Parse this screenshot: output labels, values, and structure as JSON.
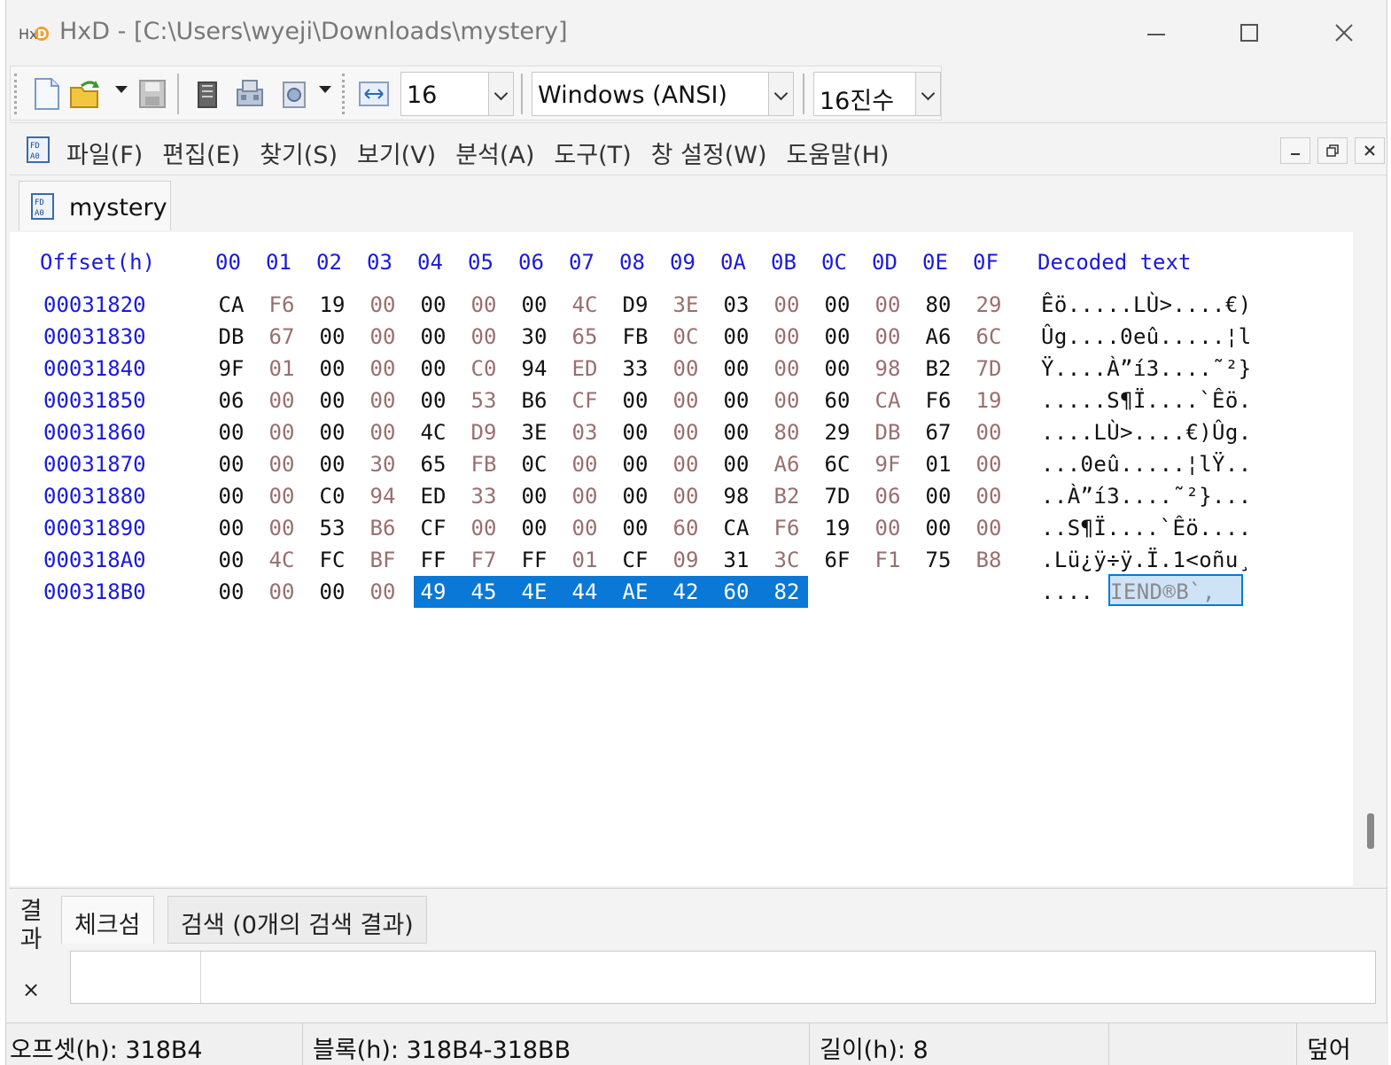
{
  "window": {
    "title": "HxD - [C:\\Users\\wyeji\\Downloads\\mystery]"
  },
  "toolbar": {
    "bytes_per_row": "16",
    "charset": "Windows (ANSI)",
    "number_base": "16진수"
  },
  "menu": {
    "items": [
      "파일(F)",
      "편집(E)",
      "찾기(S)",
      "보기(V)",
      "분석(A)",
      "도구(T)",
      "창 설정(W)",
      "도움말(H)"
    ]
  },
  "document_tab": {
    "label": "mystery"
  },
  "hex_view": {
    "offset_header": "Offset(h)",
    "columns": [
      "00",
      "01",
      "02",
      "03",
      "04",
      "05",
      "06",
      "07",
      "08",
      "09",
      "0A",
      "0B",
      "0C",
      "0D",
      "0E",
      "0F"
    ],
    "decoded_header": "Decoded text",
    "rows": [
      {
        "offset": "00031820",
        "bytes": [
          "CA",
          "F6",
          "19",
          "00",
          "00",
          "00",
          "00",
          "4C",
          "D9",
          "3E",
          "03",
          "00",
          "00",
          "00",
          "80",
          "29"
        ],
        "text": "Êö.....LÙ>....€)"
      },
      {
        "offset": "00031830",
        "bytes": [
          "DB",
          "67",
          "00",
          "00",
          "00",
          "00",
          "30",
          "65",
          "FB",
          "0C",
          "00",
          "00",
          "00",
          "00",
          "A6",
          "6C"
        ],
        "text": "Ûg....0eû.....¦l"
      },
      {
        "offset": "00031840",
        "bytes": [
          "9F",
          "01",
          "00",
          "00",
          "00",
          "C0",
          "94",
          "ED",
          "33",
          "00",
          "00",
          "00",
          "00",
          "98",
          "B2",
          "7D"
        ],
        "text": "Ÿ....À”í3....˜²}"
      },
      {
        "offset": "00031850",
        "bytes": [
          "06",
          "00",
          "00",
          "00",
          "00",
          "53",
          "B6",
          "CF",
          "00",
          "00",
          "00",
          "00",
          "60",
          "CA",
          "F6",
          "19"
        ],
        "text": ".....S¶Ï....`Êö."
      },
      {
        "offset": "00031860",
        "bytes": [
          "00",
          "00",
          "00",
          "00",
          "4C",
          "D9",
          "3E",
          "03",
          "00",
          "00",
          "00",
          "80",
          "29",
          "DB",
          "67",
          "00"
        ],
        "text": "....LÙ>....€)Ûg."
      },
      {
        "offset": "00031870",
        "bytes": [
          "00",
          "00",
          "00",
          "30",
          "65",
          "FB",
          "0C",
          "00",
          "00",
          "00",
          "00",
          "A6",
          "6C",
          "9F",
          "01",
          "00"
        ],
        "text": "...0eû.....¦lŸ.."
      },
      {
        "offset": "00031880",
        "bytes": [
          "00",
          "00",
          "C0",
          "94",
          "ED",
          "33",
          "00",
          "00",
          "00",
          "00",
          "98",
          "B2",
          "7D",
          "06",
          "00",
          "00"
        ],
        "text": "..À”í3....˜²}..."
      },
      {
        "offset": "00031890",
        "bytes": [
          "00",
          "00",
          "53",
          "B6",
          "CF",
          "00",
          "00",
          "00",
          "00",
          "60",
          "CA",
          "F6",
          "19",
          "00",
          "00",
          "00"
        ],
        "text": "..S¶Ï....`Êö...."
      },
      {
        "offset": "000318A0",
        "bytes": [
          "00",
          "4C",
          "FC",
          "BF",
          "FF",
          "F7",
          "FF",
          "01",
          "CF",
          "09",
          "31",
          "3C",
          "6F",
          "F1",
          "75",
          "B8"
        ],
        "text": ".Lü¿ÿ÷ÿ.Ï.1<oñu¸"
      },
      {
        "offset": "000318B0",
        "bytes": [
          "00",
          "00",
          "00",
          "00",
          "49",
          "45",
          "4E",
          "44",
          "AE",
          "42",
          "60",
          "82"
        ],
        "text_plain": "....",
        "text_selected": "IEND®B`‚"
      }
    ],
    "selection_color": "#0a78d7",
    "header_color": "#1a1adc"
  },
  "results_panel": {
    "side_label": "결과",
    "close": "×",
    "tabs": [
      "체크섬",
      "검색 (0개의 검색 결과)"
    ]
  },
  "statusbar": {
    "offset": "오프셋(h): 318B4",
    "block": "블록(h): 318B4-318BB",
    "length": "길이(h): 8",
    "mode": "덮어"
  }
}
